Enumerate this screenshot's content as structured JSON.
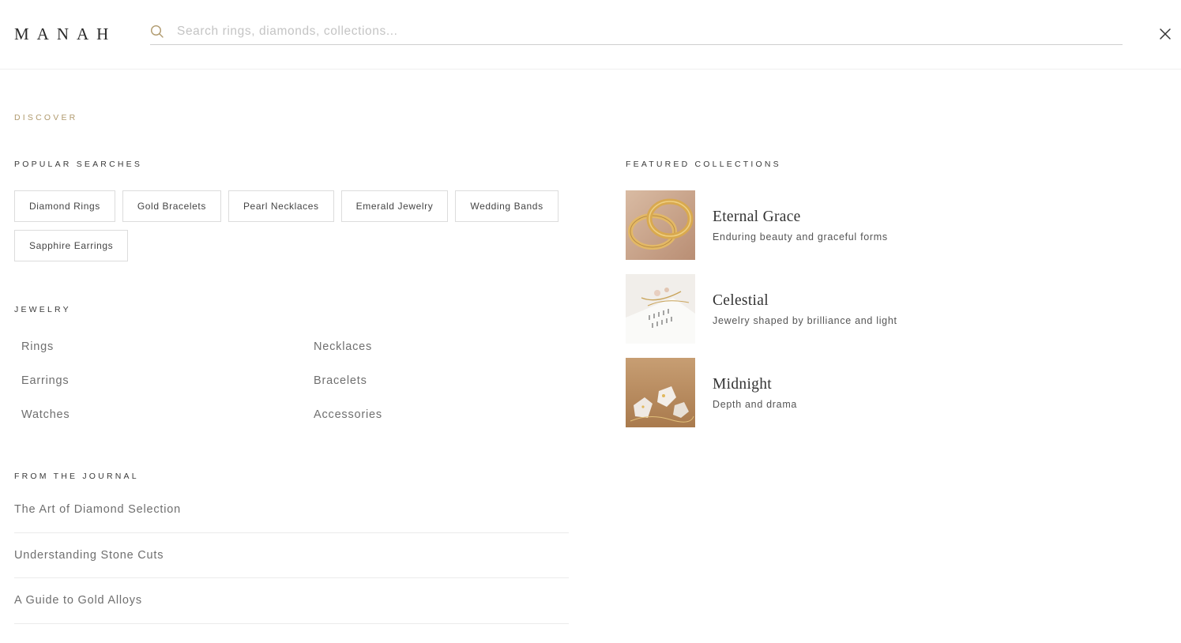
{
  "brand": {
    "logo": "MANAH"
  },
  "search": {
    "placeholder": "Search rings, diamonds, collections..."
  },
  "discover": {
    "label": "DISCOVER"
  },
  "popular": {
    "label": "POPULAR SEARCHES",
    "chips": [
      "Diamond Rings",
      "Gold Bracelets",
      "Pearl Necklaces",
      "Emerald Jewelry",
      "Wedding Bands",
      "Sapphire Earrings"
    ]
  },
  "jewelry": {
    "label": "JEWELRY",
    "links": [
      "Rings",
      "Necklaces",
      "Earrings",
      "Bracelets",
      "Watches",
      "Accessories"
    ]
  },
  "journal": {
    "label": "FROM THE JOURNAL",
    "articles": [
      "The Art of Diamond Selection",
      "Understanding Stone Cuts",
      "A Guide to Gold Alloys"
    ]
  },
  "featured": {
    "label": "FEATURED COLLECTIONS",
    "collections": [
      {
        "title": "Eternal Grace",
        "subtitle": "Enduring beauty and graceful forms"
      },
      {
        "title": "Celestial",
        "subtitle": "Jewelry shaped by brilliance and light"
      },
      {
        "title": "Midnight",
        "subtitle": "Depth and drama"
      }
    ]
  },
  "icons": {
    "search": "search-icon",
    "close": "close-icon"
  },
  "colors": {
    "accent": "#b09a6e",
    "text": "#333333",
    "muted": "#6f6f6f",
    "border": "#dcdcdc"
  }
}
